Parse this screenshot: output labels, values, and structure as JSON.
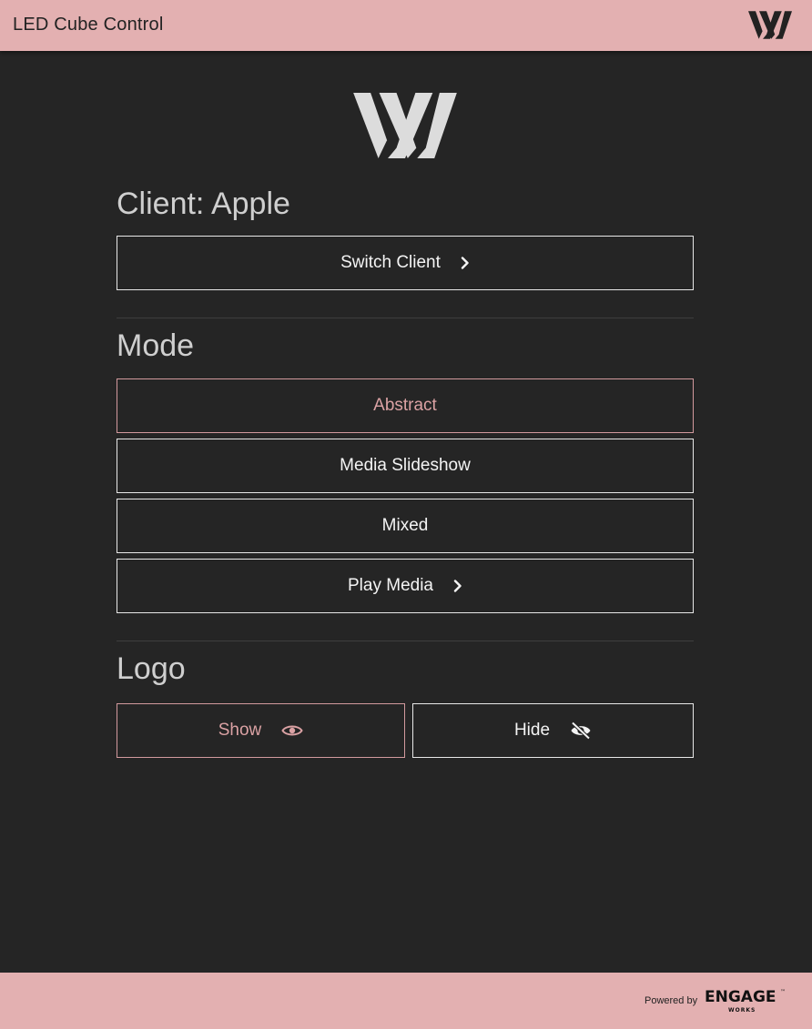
{
  "app": {
    "title": "LED Cube Control"
  },
  "client": {
    "heading": "Client: Apple",
    "switch_label": "Switch Client"
  },
  "mode": {
    "heading": "Mode",
    "options": [
      {
        "label": "Abstract",
        "active": true
      },
      {
        "label": "Media Slideshow",
        "active": false
      },
      {
        "label": "Mixed",
        "active": false
      },
      {
        "label": "Play Media",
        "active": false
      }
    ]
  },
  "logo": {
    "heading": "Logo",
    "show_label": "Show",
    "hide_label": "Hide",
    "selected": "Show"
  },
  "footer": {
    "powered_by": "Powered by",
    "brand": "ENGAGE",
    "brand_sub": "WORKS",
    "brand_mark": "™"
  },
  "colors": {
    "bar": "#e3b0b1",
    "background": "#252525",
    "accent": "#dba2a4"
  },
  "icons": {
    "brand": "w-logo-icon",
    "chevron": "chevron-right-icon",
    "show": "eye-icon",
    "hide": "eye-off-icon"
  }
}
